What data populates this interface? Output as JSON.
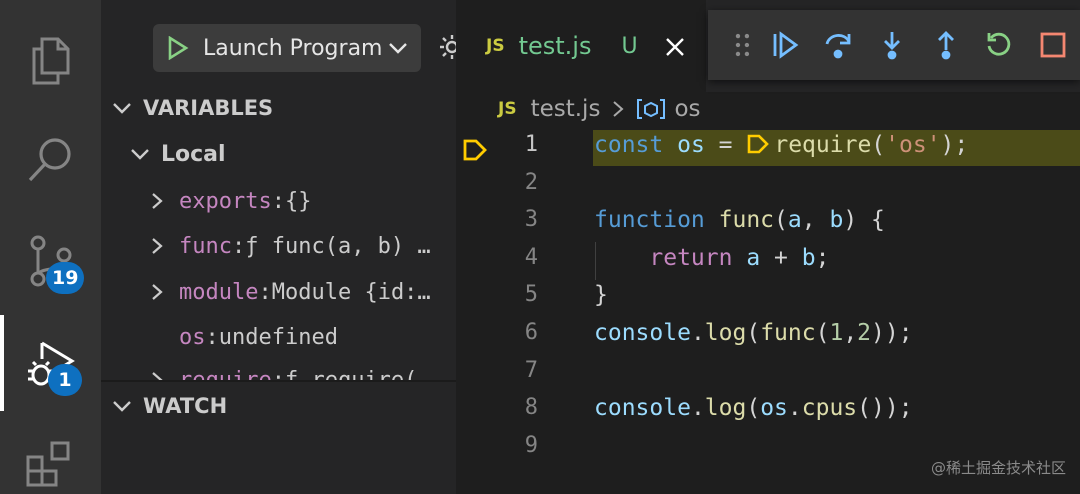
{
  "activity_bar": {
    "items": [
      {
        "name": "explorer",
        "icon": "files-icon"
      },
      {
        "name": "search",
        "icon": "search-icon"
      },
      {
        "name": "source-control",
        "icon": "source-control-icon",
        "badge": "19"
      },
      {
        "name": "run-debug",
        "icon": "debug-icon",
        "badge": "1",
        "active": true
      },
      {
        "name": "extensions",
        "icon": "extensions-icon"
      }
    ]
  },
  "side_bar": {
    "launch_config": "Launch Program",
    "variables": {
      "header": "VARIABLES",
      "scope": "Local",
      "items": [
        {
          "name": "exports",
          "sep": ": ",
          "value": "{}",
          "expandable": true
        },
        {
          "name": "func",
          "sep": ": ",
          "value": "ƒ func(a, b) …",
          "expandable": true
        },
        {
          "name": "module",
          "sep": ": ",
          "value": "Module {id:…",
          "expandable": true
        },
        {
          "name": "os",
          "sep": ": ",
          "value": "undefined",
          "expandable": false
        },
        {
          "name": "require",
          "sep": ": ",
          "value": "ƒ require(…",
          "expandable": true
        }
      ]
    },
    "watch": {
      "header": "WATCH"
    }
  },
  "editor": {
    "tab": {
      "badge": "JS",
      "title": "test.js",
      "status": "U"
    },
    "breadcrumb": {
      "file_badge": "JS",
      "file": "test.js",
      "symbol": "os"
    },
    "debug_toolbar": [
      "continue-icon",
      "step-over-icon",
      "step-into-icon",
      "step-out-icon",
      "restart-icon",
      "stop-icon"
    ],
    "current_line": 1,
    "lines": [
      {
        "n": "1",
        "t": "const os = require('os');"
      },
      {
        "n": "2",
        "t": ""
      },
      {
        "n": "3",
        "t": "function func(a, b) {"
      },
      {
        "n": "4",
        "t": "    return a + b;"
      },
      {
        "n": "5",
        "t": "}"
      },
      {
        "n": "6",
        "t": "console.log(func(1,2));"
      },
      {
        "n": "7",
        "t": ""
      },
      {
        "n": "8",
        "t": "console.log(os.cpus());"
      },
      {
        "n": "9",
        "t": ""
      }
    ]
  },
  "watermark": "@稀土掘金技术社区",
  "colors": {
    "accent": "#0e70c0",
    "git_untracked": "#73c991",
    "debug_blue": "#75beff",
    "debug_green": "#89d185",
    "debug_red": "#f48771",
    "breakpoint_yellow": "#ffcc00",
    "current_line_bg": "#4b4b18"
  }
}
